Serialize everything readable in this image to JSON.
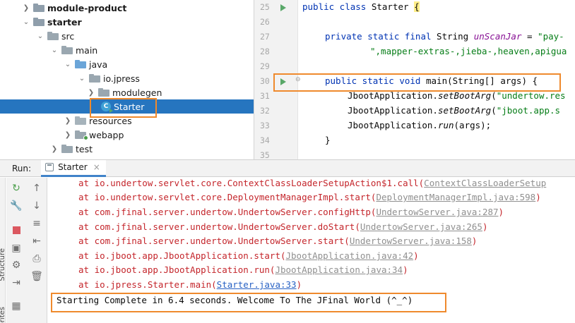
{
  "project_tree": {
    "items": [
      {
        "label": "module-product",
        "expanded": false,
        "bold": true
      },
      {
        "label": "starter",
        "expanded": true,
        "bold": true
      },
      {
        "label": "src",
        "expanded": true
      },
      {
        "label": "main",
        "expanded": true
      },
      {
        "label": "java",
        "expanded": true
      },
      {
        "label": "io.jpress",
        "expanded": true
      },
      {
        "label": "modulegen",
        "expanded": false
      },
      {
        "label": "Starter",
        "selected": true
      },
      {
        "label": "resources",
        "expanded": false
      },
      {
        "label": "webapp",
        "expanded": false
      },
      {
        "label": "test",
        "expanded": false
      }
    ]
  },
  "editor": {
    "line_numbers": [
      "25",
      "26",
      "27",
      "28",
      "29",
      "30",
      "31",
      "32",
      "33",
      "34",
      "35"
    ],
    "lines": {
      "l25": {
        "kw": "public class ",
        "rest": "Starter ",
        "brace": "{"
      },
      "l27": {
        "kw": "private static final ",
        "type": "String ",
        "field": "unScanJar",
        "eq": " = ",
        "str": "\"pay-"
      },
      "l28": {
        "str": "\",mapper-extras-,jieba-,heaven,apigua"
      },
      "l30": {
        "kw": "public static void ",
        "rest": "main(String[] args) {"
      },
      "l31": {
        "cls": "JbootApplication.",
        "method": "setBootArg",
        "open": "(",
        "str": "\"undertow.res"
      },
      "l32": {
        "cls": "JbootApplication.",
        "method": "setBootArg",
        "open": "(",
        "str": "\"jboot.app.s"
      },
      "l33": {
        "cls": "JbootApplication.",
        "method": "run",
        "args": "(args);"
      },
      "l34": {
        "text": "}"
      }
    }
  },
  "run_panel": {
    "label": "Run:",
    "tab_label": "Starter",
    "close_icon": "×"
  },
  "side_labels": {
    "structure": "Structure",
    "favorites": "Favorites"
  },
  "console": {
    "lines": [
      {
        "prefix": "at io.undertow.servlet.core.ContextClassLoaderSetupAction$1.call(",
        "link": "ContextClassLoaderSetup",
        "suffix": ""
      },
      {
        "prefix": "at io.undertow.servlet.core.DeploymentManagerImpl.start(",
        "link": "DeploymentManagerImpl.java:598",
        "suffix": ")"
      },
      {
        "prefix": "at com.jfinal.server.undertow.UndertowServer.configHttp(",
        "link": "UndertowServer.java:287",
        "suffix": ")"
      },
      {
        "prefix": "at com.jfinal.server.undertow.UndertowServer.doStart(",
        "link": "UndertowServer.java:265",
        "suffix": ")"
      },
      {
        "prefix": "at com.jfinal.server.undertow.UndertowServer.start(",
        "link": "UndertowServer.java:158",
        "suffix": ")"
      },
      {
        "prefix": "at io.jboot.app.JbootApplication.start(",
        "link": "JbootApplication.java:42",
        "suffix": ")"
      },
      {
        "prefix": "at io.jboot.app.JbootApplication.run(",
        "link": "JbootApplication.java:34",
        "suffix": ")"
      },
      {
        "prefix": "at io.jpress.Starter.main(",
        "link": "Starter.java:33",
        "suffix": ")"
      }
    ],
    "final_message": "Starting Complete in 6.4 seconds. Welcome To The JFinal World (^_^)"
  },
  "colors": {
    "selection": "#2675bf",
    "highlight_box": "#ef8a2d",
    "keyword": "#0033b3",
    "string": "#067d17",
    "field": "#871094",
    "error_text": "#c4252b"
  },
  "icons": {
    "tree_folder": "folder-icon",
    "tree_class": "java-class-icon",
    "run_gutter": "run-gutter-icon",
    "rerun": "rerun-icon",
    "wrench": "wrench-icon",
    "stop": "stop-icon",
    "camera": "camera-icon",
    "settings": "settings-icon",
    "exit": "exit-icon",
    "layout": "layout-icon",
    "up": "arrow-up-icon",
    "down": "arrow-down-icon",
    "softwrap": "soft-wrap-icon",
    "scroll_end": "scroll-to-end-icon",
    "print": "print-icon",
    "trash": "trash-icon"
  }
}
